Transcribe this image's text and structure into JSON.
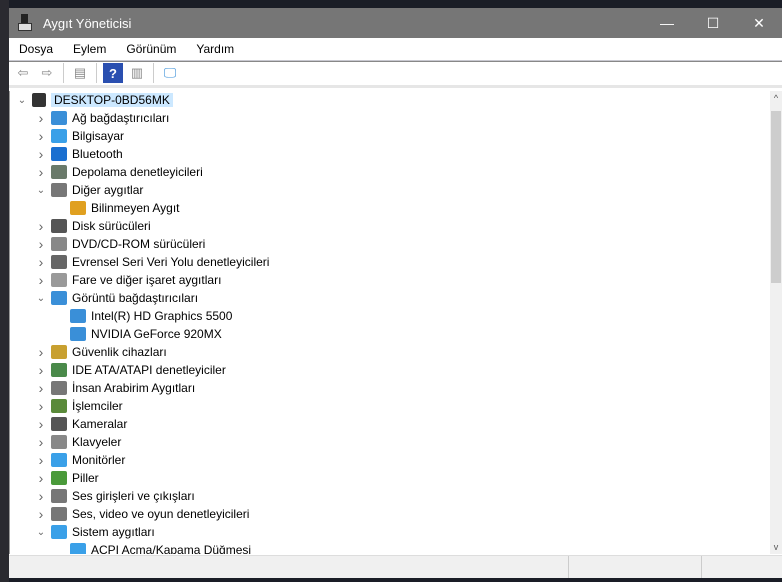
{
  "window": {
    "title": "Aygıt Yöneticisi",
    "minimize": "—",
    "maximize": "☐",
    "close": "✕"
  },
  "menu": [
    "Dosya",
    "Eylem",
    "Görünüm",
    "Yardım"
  ],
  "toolbar": [
    {
      "name": "back-icon",
      "glyph": "⇦"
    },
    {
      "name": "forward-icon",
      "glyph": "⇨"
    },
    {
      "name": "properties-icon",
      "glyph": "▤"
    },
    {
      "name": "help-icon",
      "glyph": "?"
    },
    {
      "name": "update-driver-icon",
      "glyph": "▥"
    },
    {
      "name": "scan-hardware-icon",
      "glyph": "🖵"
    }
  ],
  "tree": {
    "root": "DESKTOP-0BD56MK",
    "items": [
      {
        "label": "Ağ bağdaştırıcıları",
        "level": 1,
        "state": "collapsed",
        "color": "#3a8fd8"
      },
      {
        "label": "Bilgisayar",
        "level": 1,
        "state": "collapsed",
        "color": "#3aa0e8"
      },
      {
        "label": "Bluetooth",
        "level": 1,
        "state": "collapsed",
        "color": "#1a6fd0"
      },
      {
        "label": "Depolama denetleyicileri",
        "level": 1,
        "state": "collapsed",
        "color": "#6a7a6a"
      },
      {
        "label": "Diğer aygıtlar",
        "level": 1,
        "state": "expanded",
        "color": "#777"
      },
      {
        "label": "Bilinmeyen Aygıt",
        "level": 2,
        "state": "leaf",
        "color": "#e0a020"
      },
      {
        "label": "Disk sürücüleri",
        "level": 1,
        "state": "collapsed",
        "color": "#555"
      },
      {
        "label": "DVD/CD-ROM sürücüleri",
        "level": 1,
        "state": "collapsed",
        "color": "#888"
      },
      {
        "label": "Evrensel Seri Veri Yolu denetleyicileri",
        "level": 1,
        "state": "collapsed",
        "color": "#666"
      },
      {
        "label": "Fare ve diğer işaret aygıtları",
        "level": 1,
        "state": "collapsed",
        "color": "#999"
      },
      {
        "label": "Görüntü bağdaştırıcıları",
        "level": 1,
        "state": "expanded",
        "color": "#3a8fd8"
      },
      {
        "label": "Intel(R) HD Graphics 5500",
        "level": 2,
        "state": "leaf",
        "color": "#3a8fd8"
      },
      {
        "label": "NVIDIA GeForce 920MX",
        "level": 2,
        "state": "leaf",
        "color": "#3a8fd8"
      },
      {
        "label": "Güvenlik cihazları",
        "level": 1,
        "state": "collapsed",
        "color": "#c8a030"
      },
      {
        "label": "IDE ATA/ATAPI denetleyiciler",
        "level": 1,
        "state": "collapsed",
        "color": "#4a8a4a"
      },
      {
        "label": "İnsan Arabirim Aygıtları",
        "level": 1,
        "state": "collapsed",
        "color": "#777"
      },
      {
        "label": "İşlemciler",
        "level": 1,
        "state": "collapsed",
        "color": "#5a8a3a"
      },
      {
        "label": "Kameralar",
        "level": 1,
        "state": "collapsed",
        "color": "#555"
      },
      {
        "label": "Klavyeler",
        "level": 1,
        "state": "collapsed",
        "color": "#888"
      },
      {
        "label": "Monitörler",
        "level": 1,
        "state": "collapsed",
        "color": "#3aa0e8"
      },
      {
        "label": "Piller",
        "level": 1,
        "state": "collapsed",
        "color": "#4a9a3a"
      },
      {
        "label": "Ses girişleri ve çıkışları",
        "level": 1,
        "state": "collapsed",
        "color": "#777"
      },
      {
        "label": "Ses, video ve oyun denetleyicileri",
        "level": 1,
        "state": "collapsed",
        "color": "#777"
      },
      {
        "label": "Sistem aygıtları",
        "level": 1,
        "state": "expanded",
        "color": "#3aa0e8"
      },
      {
        "label": "ACPI Açma/Kapama Düğmesi",
        "level": 2,
        "state": "leaf",
        "color": "#3aa0e8"
      }
    ]
  }
}
